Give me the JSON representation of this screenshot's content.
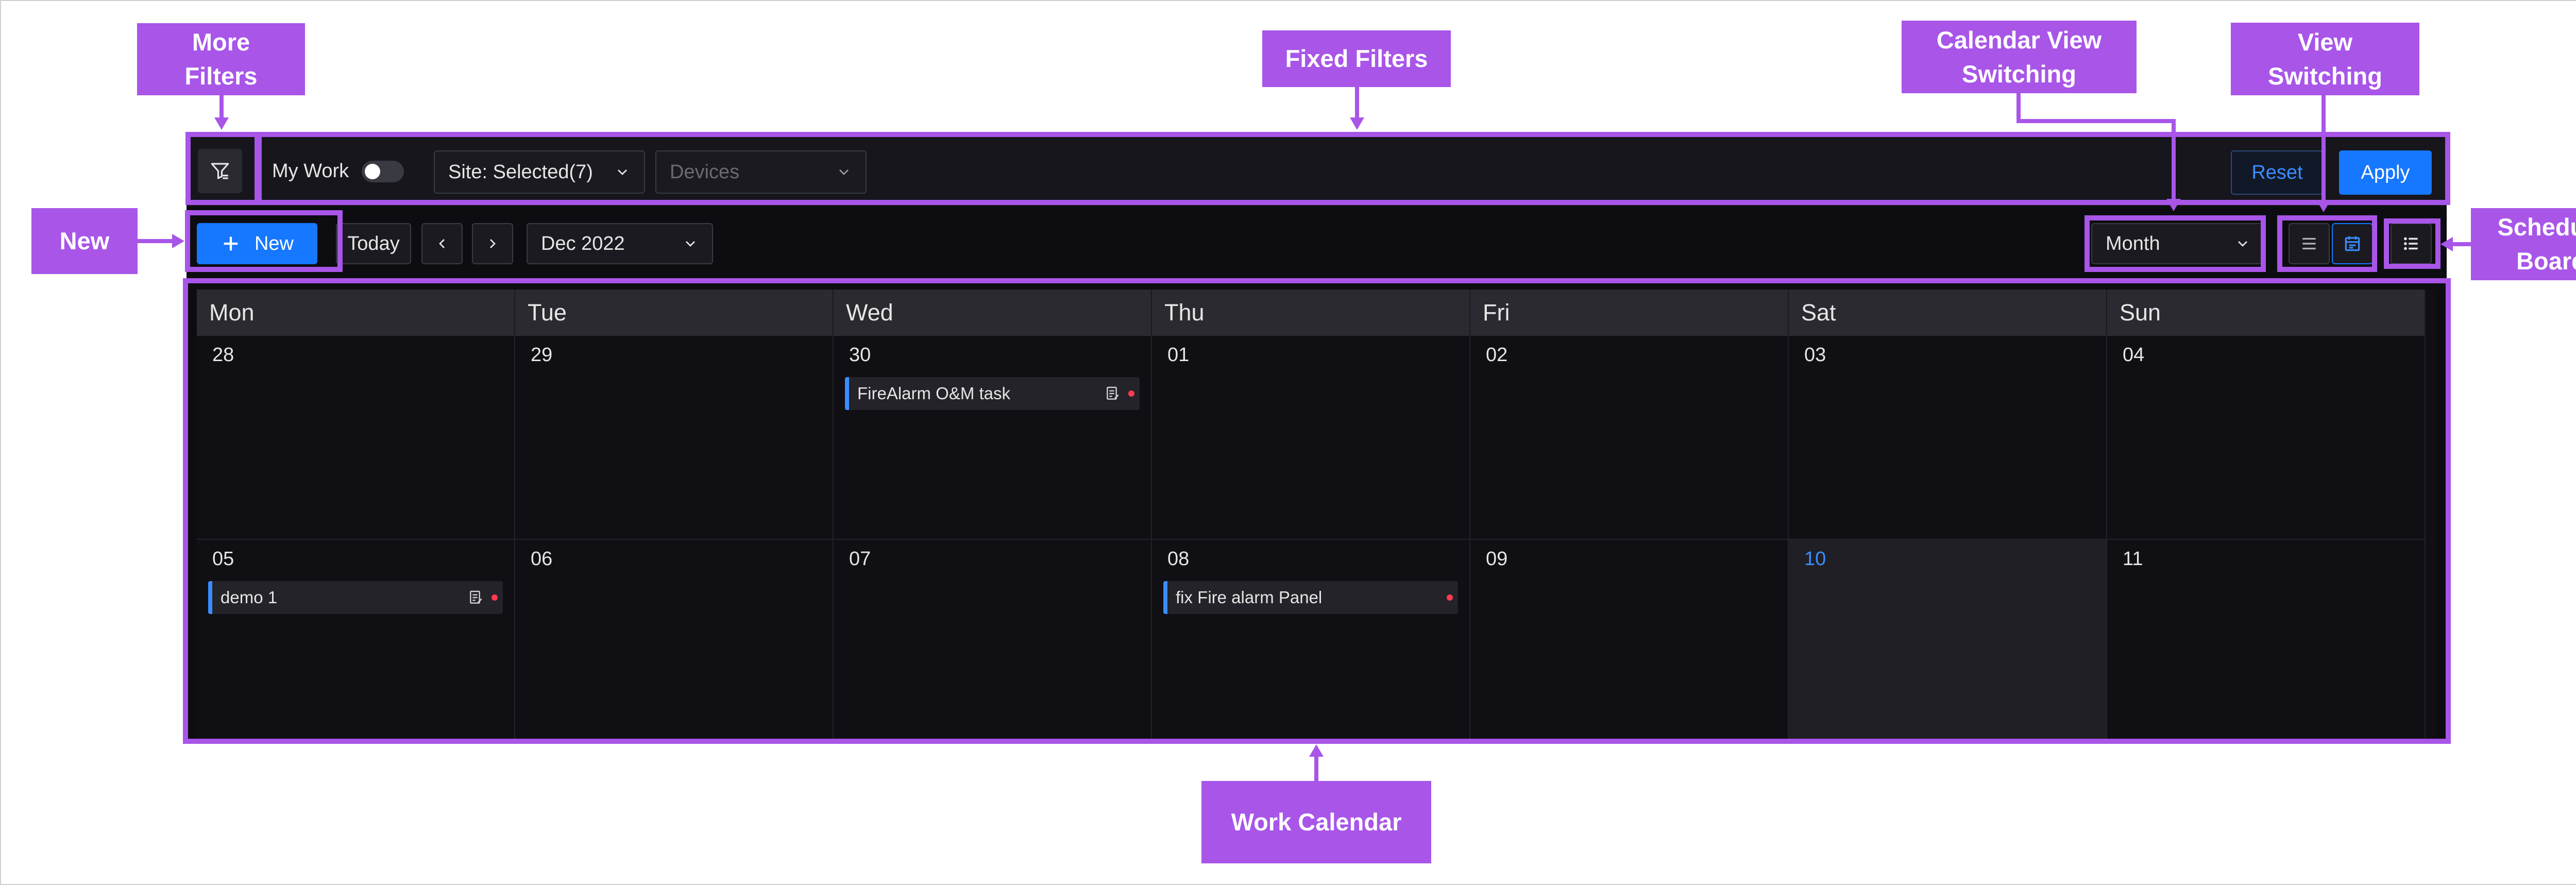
{
  "annotations": {
    "more_filters": "More\nFilters",
    "fixed_filters": "Fixed Filters",
    "calendar_view_switching": "Calendar View\nSwitching",
    "view_switching": "View\nSwitching",
    "new": "New",
    "schedule_board": "Schedule\nBoard",
    "work_calendar": "Work Calendar",
    "color": "#a855e8"
  },
  "filter_bar": {
    "my_work_label": "My Work",
    "my_work_on": false,
    "site_select": "Site: Selected(7)",
    "devices_placeholder": "Devices",
    "reset_label": "Reset",
    "apply_label": "Apply"
  },
  "toolbar": {
    "new_label": "New",
    "today_label": "Today",
    "period": "Dec 2022",
    "view_mode": "Month"
  },
  "calendar": {
    "weekdays": [
      "Mon",
      "Tue",
      "Wed",
      "Thu",
      "Fri",
      "Sat",
      "Sun"
    ],
    "weeks": [
      [
        {
          "day": "28",
          "event": ""
        },
        {
          "day": "29",
          "event": ""
        },
        {
          "day": "30",
          "event": "FireAlarm O&M task",
          "icon": true
        },
        {
          "day": "01",
          "event": ""
        },
        {
          "day": "02",
          "event": ""
        },
        {
          "day": "03",
          "event": ""
        },
        {
          "day": "04",
          "event": ""
        }
      ],
      [
        {
          "day": "05",
          "event": "demo 1",
          "icon": true
        },
        {
          "day": "06",
          "event": ""
        },
        {
          "day": "07",
          "event": ""
        },
        {
          "day": "08",
          "event": "fix Fire alarm Panel",
          "icon": false
        },
        {
          "day": "09",
          "event": ""
        },
        {
          "day": "10",
          "event": "",
          "today": true
        },
        {
          "day": "11",
          "event": ""
        }
      ]
    ]
  },
  "colors": {
    "accent": "#1677ff",
    "today_text": "#3a8dff",
    "event_bar": "#3a8dff",
    "event_dot": "#ff3b4f",
    "background": "#0d0d11"
  }
}
